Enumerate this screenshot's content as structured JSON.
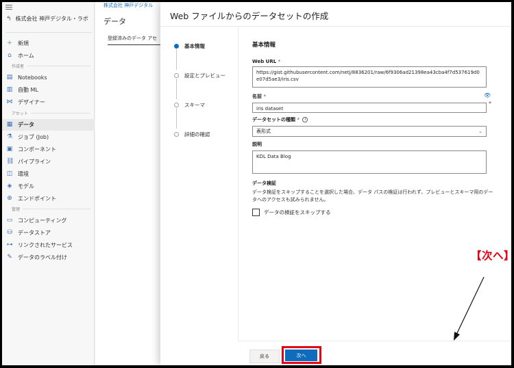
{
  "sidebar": {
    "workspace": "株式会社 神戸デジタル・ラボ",
    "items_top": [
      {
        "label": "新規",
        "icon": "plus-icon"
      },
      {
        "label": "ホーム",
        "icon": "home-icon"
      }
    ],
    "group_author": "作成者",
    "items_author": [
      {
        "label": "Notebooks",
        "icon": "notebook-icon"
      },
      {
        "label": "自動 ML",
        "icon": "automl-icon"
      },
      {
        "label": "デザイナー",
        "icon": "designer-icon"
      }
    ],
    "group_assets": "アセット",
    "items_assets": [
      {
        "label": "データ",
        "icon": "data-icon"
      },
      {
        "label": "ジョブ (Job)",
        "icon": "flask-icon"
      },
      {
        "label": "コンポーネント",
        "icon": "component-icon"
      },
      {
        "label": "パイプライン",
        "icon": "pipeline-icon"
      },
      {
        "label": "環境",
        "icon": "environment-icon"
      },
      {
        "label": "モデル",
        "icon": "model-icon"
      },
      {
        "label": "エンドポイント",
        "icon": "endpoint-icon"
      }
    ],
    "group_manage": "管理",
    "items_manage": [
      {
        "label": "コンピューティング",
        "icon": "compute-icon"
      },
      {
        "label": "データストア",
        "icon": "datastore-icon"
      },
      {
        "label": "リンクされたサービス",
        "icon": "link-icon"
      },
      {
        "label": "データのラベル付け",
        "icon": "labeling-icon"
      }
    ]
  },
  "background_page": {
    "breadcrumb": "株式会社 神戸デジタル",
    "title": "データ",
    "tab": "登録済みのデータ アセ"
  },
  "panel": {
    "title": "Web ファイルからのデータセットの作成",
    "steps": [
      {
        "label": "基本情報",
        "active": true
      },
      {
        "label": "設定とプレビュー",
        "active": false
      },
      {
        "label": "スキーマ",
        "active": false
      },
      {
        "label": "詳細の確認",
        "active": false
      }
    ],
    "section_title": "基本情報",
    "web_url": {
      "label": "Web URL",
      "required": "*",
      "value": "https://gist.githubusercontent.com/netj/8836201/raw/6f9306ad21398ea43cba4f7d537619d0e07d5ae3/iris.csv"
    },
    "name": {
      "label": "名前",
      "required": "*",
      "value": "iris dataset"
    },
    "dataset_type": {
      "label": "データセットの種類",
      "required": "*",
      "value": "表形式"
    },
    "description": {
      "label": "説明",
      "value": "KDL Data Blog"
    },
    "validation": {
      "title": "データ検証",
      "text": "データ検証をスキップすることを選択した場合、データ パスの検証は行われず、プレビューとスキーマ用のデータへのアクセスも試みられません。",
      "checkbox_label": "データの検証をスキップする"
    },
    "back_button": "戻る",
    "next_button": "次へ"
  },
  "annotation": {
    "text": "【次へ】をクリック",
    "color": "#e60012"
  }
}
